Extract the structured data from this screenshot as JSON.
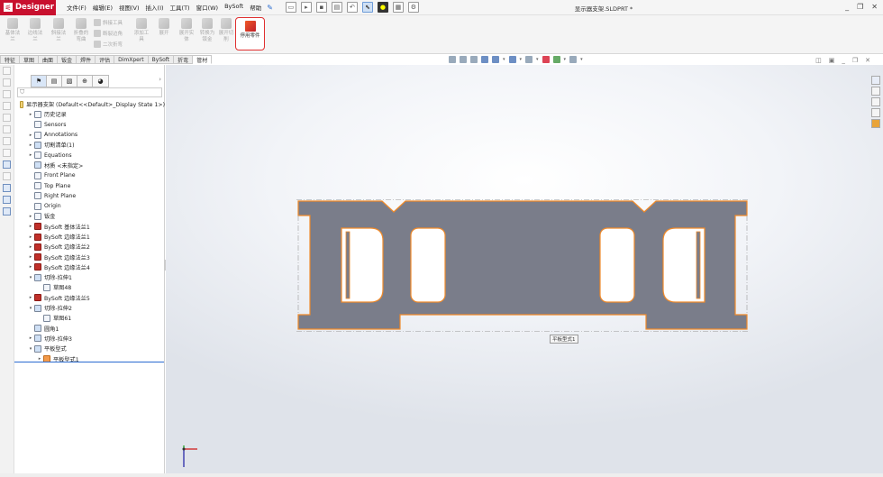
{
  "app": {
    "name": "Designer",
    "doc_title": "显示器支架.SLDPRT *"
  },
  "menu": [
    "文件(F)",
    "编辑(E)",
    "视图(V)",
    "插入(I)",
    "工具(T)",
    "窗口(W)",
    "BySoft",
    "帮助"
  ],
  "ribbon": {
    "buttons": [
      {
        "label": "基体法兰"
      },
      {
        "label": "边线法兰"
      },
      {
        "label": "斜接法兰"
      },
      {
        "label": "折叠的弯曲"
      },
      {
        "label": "添加工具"
      },
      {
        "label": "展开"
      },
      {
        "label": "转换为钣金"
      }
    ],
    "small": [
      "斜接工具",
      "断裂边角",
      "二次折弯"
    ],
    "flatten_button": "停用零件",
    "extra_labels": [
      "展开实体",
      "折叠",
      "展开切削"
    ]
  },
  "tabs": [
    "特征",
    "草图",
    "曲面",
    "钣金",
    "焊件",
    "评估",
    "DimXpert",
    "BySoft",
    "折弯",
    "管材"
  ],
  "active_tab": "管材",
  "tree": [
    {
      "label": "显示器支架  (Default<<Default>_Display State 1>)",
      "indent": 0,
      "arrow": "",
      "icon": "yel"
    },
    {
      "label": "历史记录",
      "indent": 1,
      "arrow": "▸",
      "icon": ""
    },
    {
      "label": "Sensors",
      "indent": 1,
      "arrow": "",
      "icon": ""
    },
    {
      "label": "Annotations",
      "indent": 1,
      "arrow": "▸",
      "icon": ""
    },
    {
      "label": "切割清单(1)",
      "indent": 1,
      "arrow": "▸",
      "icon": "blue"
    },
    {
      "label": "Equations",
      "indent": 1,
      "arrow": "▸",
      "icon": ""
    },
    {
      "label": "材质 <未指定>",
      "indent": 1,
      "arrow": "",
      "icon": "blue"
    },
    {
      "label": "Front Plane",
      "indent": 1,
      "arrow": "",
      "icon": ""
    },
    {
      "label": "Top Plane",
      "indent": 1,
      "arrow": "",
      "icon": ""
    },
    {
      "label": "Right Plane",
      "indent": 1,
      "arrow": "",
      "icon": ""
    },
    {
      "label": "Origin",
      "indent": 1,
      "arrow": "",
      "icon": ""
    },
    {
      "label": "钣金",
      "indent": 1,
      "arrow": "▸",
      "icon": ""
    },
    {
      "label": "BySoft 基体法兰1",
      "indent": 1,
      "arrow": "▸",
      "icon": "red"
    },
    {
      "label": "BySoft 边缘法兰1",
      "indent": 1,
      "arrow": "▸",
      "icon": "red"
    },
    {
      "label": "BySoft 边缘法兰2",
      "indent": 1,
      "arrow": "▸",
      "icon": "red"
    },
    {
      "label": "BySoft 边缘法兰3",
      "indent": 1,
      "arrow": "▸",
      "icon": "red"
    },
    {
      "label": "BySoft 边缘法兰4",
      "indent": 1,
      "arrow": "▸",
      "icon": "red"
    },
    {
      "label": "切除-拉伸1",
      "indent": 1,
      "arrow": "▾",
      "icon": "blue"
    },
    {
      "label": "草图48",
      "indent": 2,
      "arrow": "",
      "icon": ""
    },
    {
      "label": "BySoft 边缘法兰5",
      "indent": 1,
      "arrow": "▸",
      "icon": "red"
    },
    {
      "label": "切除-拉伸2",
      "indent": 1,
      "arrow": "▾",
      "icon": "blue"
    },
    {
      "label": "草图61",
      "indent": 2,
      "arrow": "",
      "icon": ""
    },
    {
      "label": "圆角1",
      "indent": 1,
      "arrow": "",
      "icon": "blue"
    },
    {
      "label": "切除-拉伸3",
      "indent": 1,
      "arrow": "▸",
      "icon": "blue"
    },
    {
      "label": "平板型式",
      "indent": 1,
      "arrow": "▾",
      "icon": "blue"
    },
    {
      "label": "平板型式1",
      "indent": 2,
      "arrow": "▸",
      "icon": "org"
    }
  ],
  "viewport": {
    "flat_pattern_label": "平板型式1"
  },
  "colors": {
    "part_fill": "#7a7d8a",
    "part_edge": "#f08a2a",
    "accent": "#2a6bd0",
    "highlight_border": "#e03030"
  }
}
